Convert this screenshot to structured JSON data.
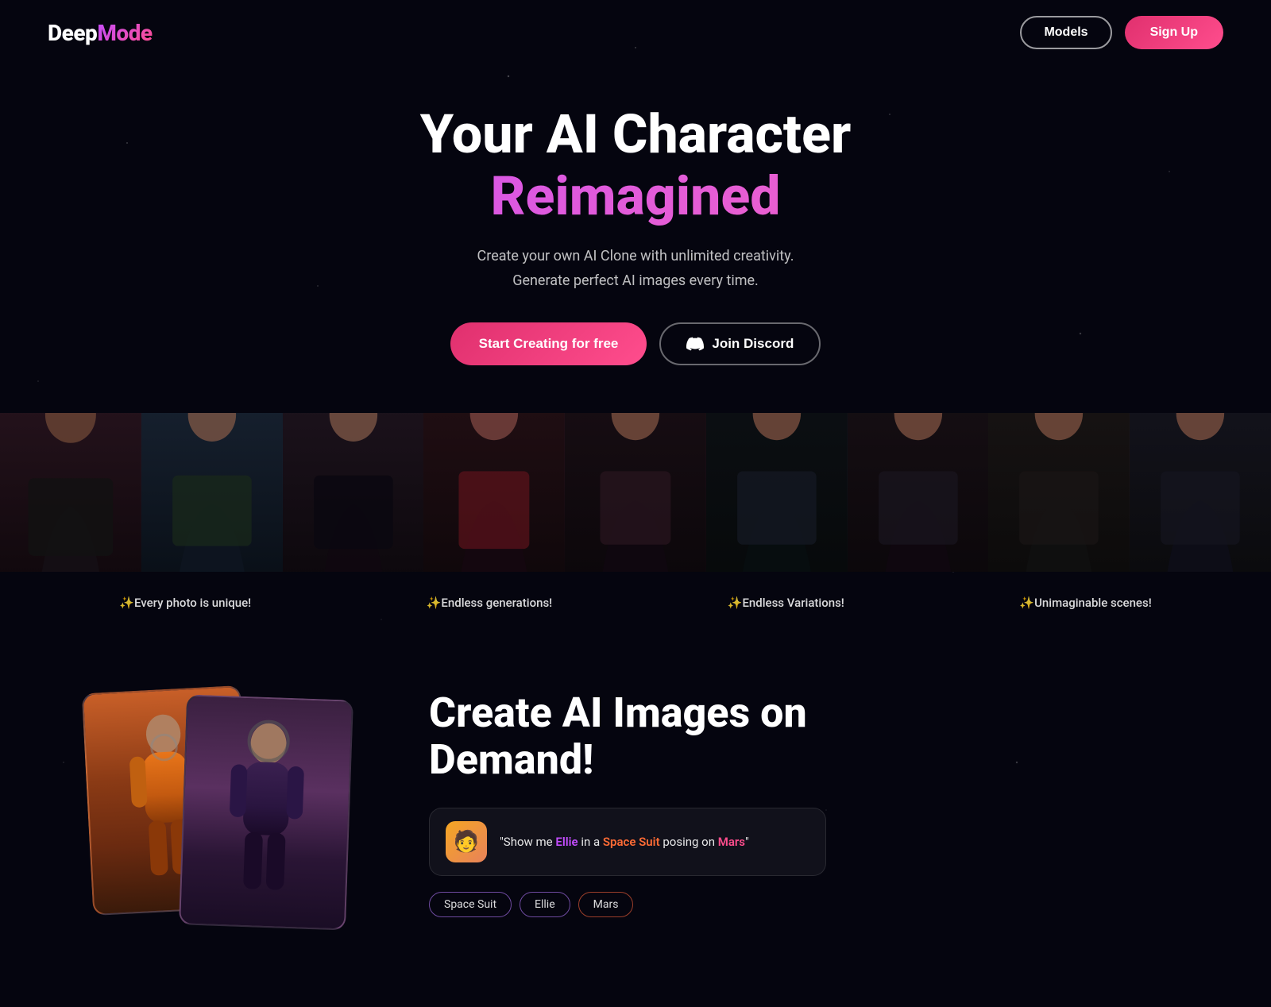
{
  "brand": {
    "name_deep": "Deep",
    "name_mode": "Mode",
    "full": "DeepMode"
  },
  "nav": {
    "models_label": "Models",
    "signup_label": "Sign Up"
  },
  "hero": {
    "title_line1": "Your AI Character",
    "title_line2": "Reimagined",
    "subtitle_line1": "Create your own AI Clone with unlimited creativity.",
    "subtitle_line2": "Generate perfect AI images every time.",
    "btn_start": "Start Creating for free",
    "btn_discord": "Join Discord"
  },
  "features": [
    {
      "label": "✨Every photo is unique!"
    },
    {
      "label": "✨Endless generations!"
    },
    {
      "label": "✨Endless Variations!"
    },
    {
      "label": "✨Unimaginable scenes!"
    }
  ],
  "bottom": {
    "title_line1": "Create AI Images on",
    "title_line2": "Demand!",
    "prompt_avatar_emoji": "🧑",
    "prompt_text_prefix": "\"Show me",
    "prompt_name": "Ellie",
    "prompt_text_mid1": "in a",
    "prompt_item": "Space Suit",
    "prompt_text_mid2": "posing on",
    "prompt_location": "Mars",
    "prompt_text_suffix": "\"",
    "tags": [
      {
        "label": "Space Suit",
        "style": "space-suit"
      },
      {
        "label": "Ellie",
        "style": "ellie"
      },
      {
        "label": "Mars",
        "style": "mars"
      }
    ]
  },
  "colors": {
    "accent_pink": "#e0306e",
    "accent_purple": "#c44dff",
    "bg_dark": "#05050f"
  }
}
